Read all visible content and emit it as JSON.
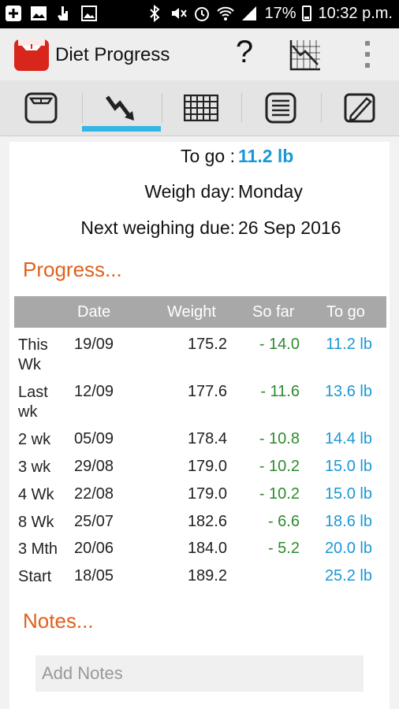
{
  "status_bar": {
    "battery": "17%",
    "time": "10:32 p.m."
  },
  "action_bar": {
    "title": "Diet Progress",
    "help_label": "?"
  },
  "tabs": [
    {
      "name": "scale-icon"
    },
    {
      "name": "progress-chart-icon",
      "selected": true
    },
    {
      "name": "calendar-grid-icon"
    },
    {
      "name": "list-icon"
    },
    {
      "name": "edit-icon"
    }
  ],
  "summary": {
    "to_go_label": "To go :",
    "to_go_value": "11.2 lb",
    "weigh_day_label": "Weigh day:",
    "weigh_day_value": "Monday",
    "next_weighing_label": "Next weighing due:",
    "next_weighing_value": "26 Sep 2016"
  },
  "progress": {
    "title": "Progress...",
    "columns": [
      "Date",
      "Weight",
      "So far",
      "To go"
    ],
    "rows": [
      {
        "label": "This Wk",
        "date": "19/09",
        "weight": "175.2",
        "so_far": "- 14.0",
        "to_go": "11.2 lb"
      },
      {
        "label": "Last wk",
        "date": "12/09",
        "weight": "177.6",
        "so_far": "- 11.6",
        "to_go": "13.6 lb"
      },
      {
        "label": "2 wk",
        "date": "05/09",
        "weight": "178.4",
        "so_far": "- 10.8",
        "to_go": "14.4 lb"
      },
      {
        "label": "3 wk",
        "date": "29/08",
        "weight": "179.0",
        "so_far": "- 10.2",
        "to_go": "15.0 lb"
      },
      {
        "label": "4 Wk",
        "date": "22/08",
        "weight": "179.0",
        "so_far": "- 10.2",
        "to_go": "15.0 lb"
      },
      {
        "label": "8 Wk",
        "date": "25/07",
        "weight": "182.6",
        "so_far": "- 6.6",
        "to_go": "18.6 lb"
      },
      {
        "label": "3 Mth",
        "date": "20/06",
        "weight": "184.0",
        "so_far": "- 5.2",
        "to_go": "20.0 lb"
      },
      {
        "label": "Start",
        "date": "18/05",
        "weight": "189.2",
        "so_far": "",
        "to_go": "25.2 lb"
      }
    ]
  },
  "notes": {
    "title": "Notes...",
    "placeholder": "Add Notes"
  },
  "colors": {
    "accent_orange": "#e0601c",
    "blue": "#1a98d5",
    "green": "#2e8b2e",
    "tab_highlight": "#33b5e5"
  }
}
